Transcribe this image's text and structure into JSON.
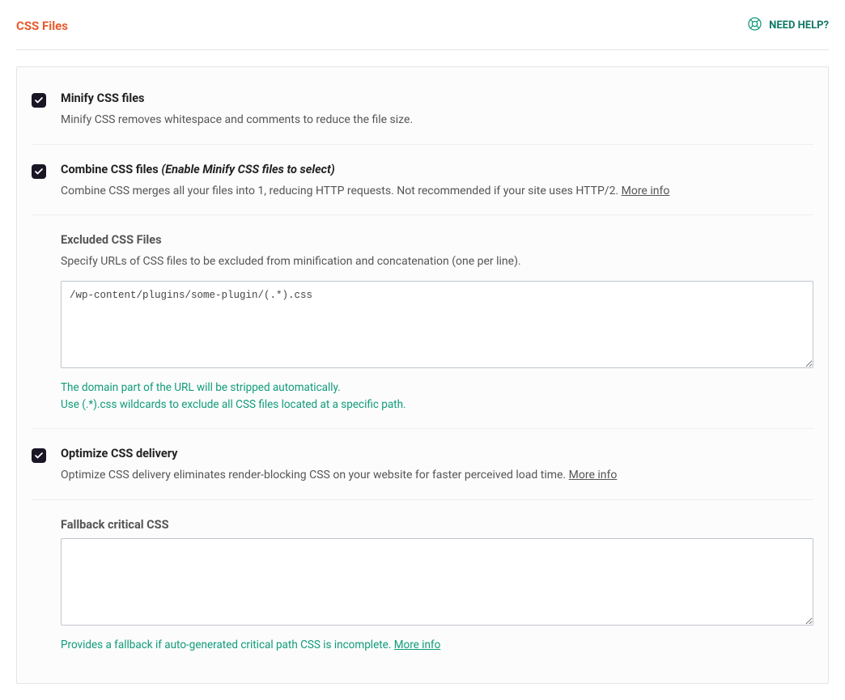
{
  "header": {
    "title": "CSS Files",
    "help_label": "NEED HELP?"
  },
  "options": {
    "minify": {
      "checked": true,
      "title": "Minify CSS files",
      "desc": "Minify CSS removes whitespace and comments to reduce the file size."
    },
    "combine": {
      "checked": true,
      "title_main": "Combine CSS files",
      "title_note": "(Enable Minify CSS files to select)",
      "desc_pre": "Combine CSS merges all your files into 1, reducing HTTP requests. Not recommended if your site uses HTTP/2. ",
      "more_info": "More info"
    },
    "excluded": {
      "title": "Excluded CSS Files",
      "desc": "Specify URLs of CSS files to be excluded from minification and concatenation (one per line).",
      "value": "/wp-content/plugins/some-plugin/(.*).css",
      "hint_line1": "The domain part of the URL will be stripped automatically.",
      "hint_line2": "Use (.*).css wildcards to exclude all CSS files located at a specific path."
    },
    "optimize": {
      "checked": true,
      "title": "Optimize CSS delivery",
      "desc_pre": "Optimize CSS delivery eliminates render-blocking CSS on your website for faster perceived load time. ",
      "more_info": "More info"
    },
    "fallback": {
      "title": "Fallback critical CSS",
      "value": "",
      "hint_pre": "Provides a fallback if auto-generated critical path CSS is incomplete. ",
      "more_info": "More info"
    }
  }
}
